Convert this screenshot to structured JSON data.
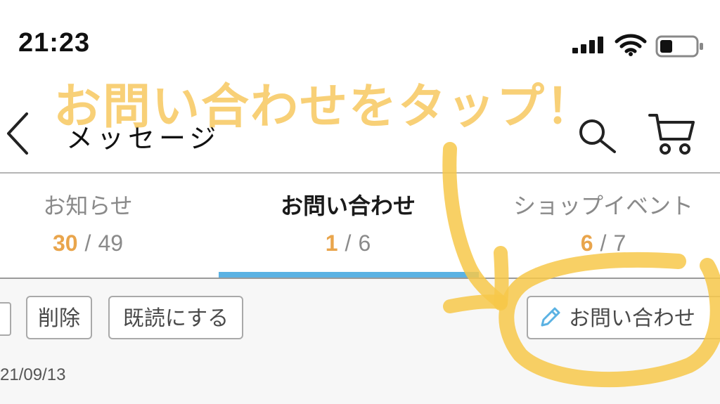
{
  "status_bar": {
    "time": "21:23",
    "icons": [
      "signal-icon",
      "wifi-icon",
      "battery-icon"
    ]
  },
  "header": {
    "title": "メッセージ",
    "back_icon": "chevron-left-icon",
    "search_icon": "search-icon",
    "cart_icon": "cart-icon"
  },
  "tabs": [
    {
      "label": "お知らせ",
      "unread": "30",
      "total": "49",
      "active": false
    },
    {
      "label": "お問い合わせ",
      "unread": "1",
      "total": "6",
      "active": true
    },
    {
      "label": "ショップイベント",
      "unread": "6",
      "total": "7",
      "active": false
    }
  ],
  "toolbar": {
    "delete_label": "削除",
    "mark_read_label": "既読にする",
    "inquiry_label": "お問い合わせ",
    "inquiry_icon": "pencil-icon"
  },
  "message": {
    "date": "21/09/13"
  },
  "annotation": {
    "text": "お問い合わせをタップ！"
  },
  "colors": {
    "accent_blue": "#5bb2e3",
    "unread_orange": "#e9a54c",
    "annotation_yellow": "#f7c860"
  }
}
